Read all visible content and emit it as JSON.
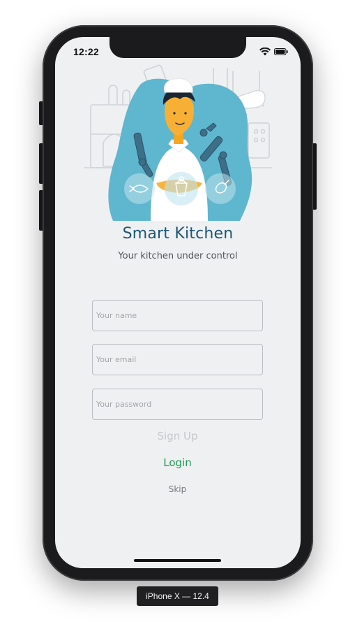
{
  "status_bar": {
    "time": "12:22",
    "icons": [
      "wifi-icon",
      "battery-icon"
    ]
  },
  "hero": {
    "illustration": "chef-with-robot-arms"
  },
  "app": {
    "title": "Smart Kitchen",
    "subtitle": "Your kitchen under control"
  },
  "form": {
    "name_placeholder": "Your name",
    "name_value": "",
    "email_placeholder": "Your email",
    "email_value": "",
    "password_placeholder": "Your password",
    "password_value": ""
  },
  "actions": {
    "signup_label": "Sign Up",
    "login_label": "Login",
    "skip_label": "Skip"
  },
  "simulator": {
    "device_label": "iPhone X — 12.4"
  },
  "colors": {
    "title": "#1d5774",
    "login": "#1b9a54",
    "hero_blob": "#5fb6cf",
    "screen_bg": "#eff0f2"
  }
}
